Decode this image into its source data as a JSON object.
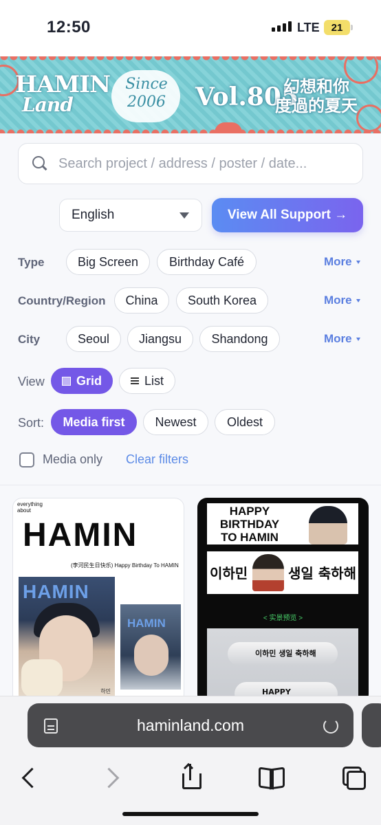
{
  "status_bar": {
    "time": "12:50",
    "network": "LTE",
    "battery": "21"
  },
  "banner": {
    "logo_line1": "HAMIN",
    "logo_line2": "Land",
    "since_word": "Since",
    "since_year": "2006",
    "volume": "Vol.805",
    "slogan_line1": "幻想和你",
    "slogan_line2": "度過的夏天"
  },
  "search": {
    "placeholder": "Search project / address / poster / date..."
  },
  "language": {
    "selected": "English"
  },
  "view_all_button": "View All Support →",
  "filters": {
    "type": {
      "label": "Type",
      "options": [
        "Big Screen",
        "Birthday Café"
      ],
      "more": "More"
    },
    "country": {
      "label": "Country/Region",
      "options": [
        "China",
        "South Korea"
      ],
      "more": "More"
    },
    "city": {
      "label": "City",
      "options": [
        "Seoul",
        "Jiangsu",
        "Shandong"
      ],
      "more": "More"
    }
  },
  "view": {
    "label": "View",
    "grid": "Grid",
    "list": "List",
    "selected": "Grid"
  },
  "sort": {
    "label": "Sort:",
    "options": [
      "Media first",
      "Newest",
      "Oldest"
    ],
    "selected": "Media first"
  },
  "media_only": {
    "label": "Media only",
    "checked": false
  },
  "clear_filters": "Clear filters",
  "cards": [
    {
      "small_text": "everything about",
      "title": "HAMIN",
      "subtitle": "(李河民生日快乐) Happy Birthday To HAMIN",
      "magazine_title": "HAMIN",
      "magazine_caption": "하민",
      "billboard_title": "HAMIN"
    },
    {
      "banner_text": "HAPPY BIRTHDAY TO HAMIN",
      "korean_name": "이하민",
      "korean_wish": "생일 축하해",
      "preview_label": "< 实景预览 >",
      "blimp_text": "이하민 생일 축하해",
      "blimp2_text": "HAPPY"
    }
  ],
  "browser": {
    "url": "haminland.com"
  },
  "colors": {
    "accent_purple": "#7458e7",
    "gradient_start": "#5b8cf2",
    "link_blue": "#5b7fe0"
  }
}
